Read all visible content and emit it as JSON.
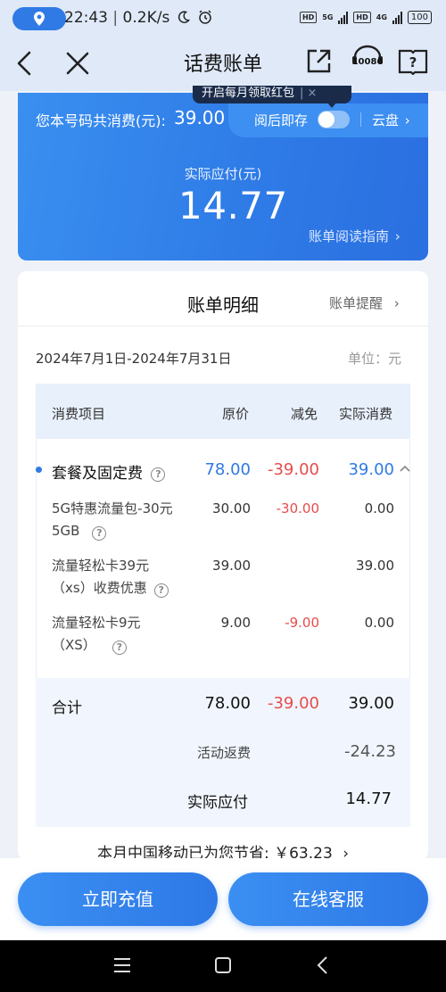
{
  "status_bar": {
    "time": "22:43",
    "network_speed": "0.2K/s",
    "sim1_label": "5G",
    "sim2_label": "4G",
    "hd_label": "HD",
    "battery": "100"
  },
  "header": {
    "title": "话费账单",
    "back_icon": "back-chevron-icon",
    "close_icon": "close-icon",
    "share_icon": "share-icon",
    "service_label": "10086",
    "help_icon": "help-book-icon"
  },
  "summary": {
    "tooltip": "开启每月领取红包",
    "total_label": "您本号码共消费(元):",
    "total_value": "39.00",
    "save_toggle_label": "阅后即存",
    "save_toggle_on": false,
    "cloud_label": "云盘",
    "due_label": "实际应付(元)",
    "due_value": "14.77",
    "guide_link": "账单阅读指南"
  },
  "detail": {
    "title": "账单明细",
    "reminder_link": "账单提醒",
    "period": "2024年7月1日-2024年7月31日",
    "unit": "单位：元",
    "columns": [
      "消费项目",
      "原价",
      "减免",
      "实际消费"
    ],
    "group": {
      "name": "套餐及固定费",
      "original": "78.00",
      "discount": "-39.00",
      "actual": "39.00"
    },
    "rows": [
      {
        "name_line1": "5G特惠流量包-30元",
        "name_line2": "5GB",
        "original": "30.00",
        "discount": "-30.00",
        "actual": "0.00"
      },
      {
        "name_line1": "流量轻松卡39元",
        "name_line2": "（xs）收费优惠",
        "original": "39.00",
        "discount": "",
        "actual": "39.00"
      },
      {
        "name_line1": "流量轻松卡9元",
        "name_line2": "（XS）",
        "original": "9.00",
        "discount": "-9.00",
        "actual": "0.00"
      }
    ],
    "total": {
      "label": "合计",
      "original": "78.00",
      "discount": "-39.00",
      "actual": "39.00"
    },
    "rebate": {
      "label": "活动返费",
      "value": "-24.23"
    },
    "payable": {
      "label": "实际应付",
      "value": "14.77"
    },
    "savings": "本月中国移动已为您节省: ￥63.23"
  },
  "buttons": {
    "recharge": "立即充值",
    "service": "在线客服"
  },
  "colors": {
    "accent": "#2f7ae5",
    "discount_red": "#e84b4b",
    "card_bg": "#ffffff"
  }
}
